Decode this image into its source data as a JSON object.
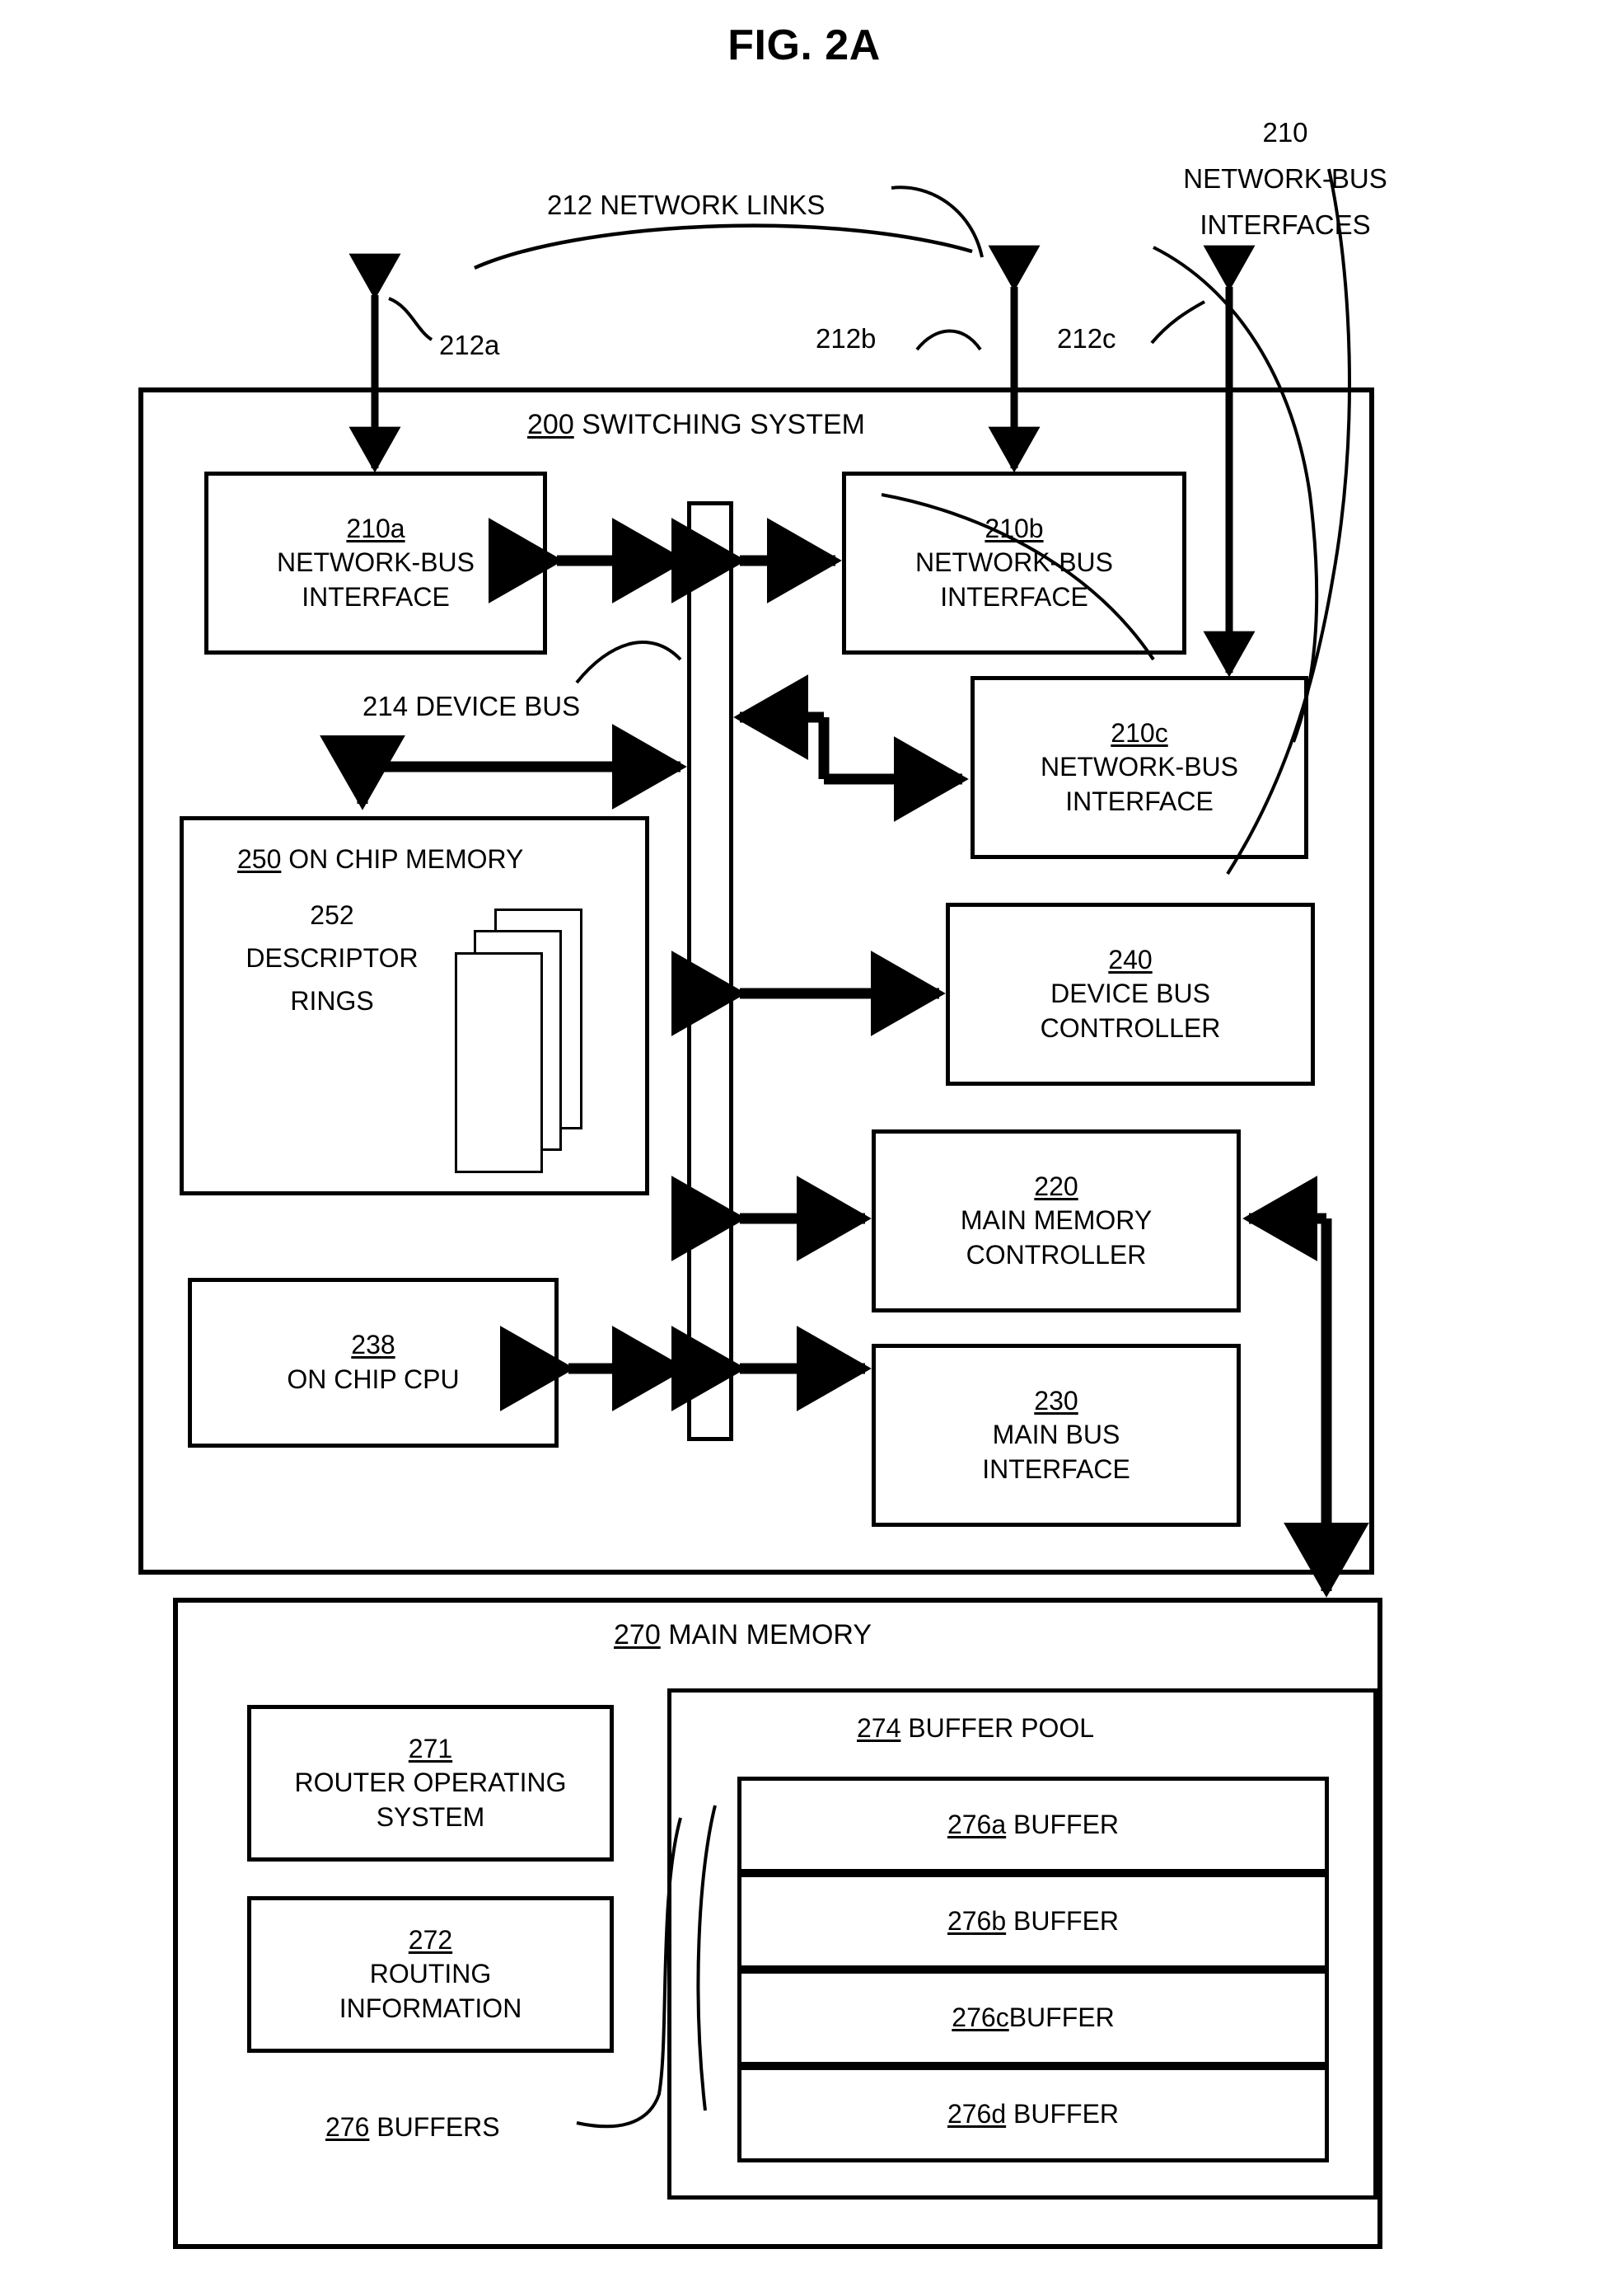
{
  "figure": {
    "title": "FIG. 2A"
  },
  "callouts": {
    "network_links": "212 NETWORK LINKS",
    "nbi_group_num": "210",
    "nbi_group_line1": "NETWORK-BUS",
    "nbi_group_line2": "INTERFACES",
    "link_a": "212a",
    "link_b": "212b",
    "link_c": "212c",
    "device_bus": "214 DEVICE BUS",
    "buffers": "276 BUFFERS"
  },
  "switching_system": {
    "num": "200",
    "name": "SWITCHING SYSTEM",
    "blocks": [
      {
        "id": "210a",
        "num": "210a",
        "line1": "NETWORK-BUS",
        "line2": "INTERFACE"
      },
      {
        "id": "210b",
        "num": "210b",
        "line1": "NETWORK-BUS",
        "line2": "INTERFACE"
      },
      {
        "id": "210c",
        "num": "210c",
        "line1": "NETWORK-BUS",
        "line2": "INTERFACE"
      },
      {
        "id": "240",
        "num": "240",
        "line1": "DEVICE BUS",
        "line2": "CONTROLLER"
      },
      {
        "id": "220",
        "num": "220",
        "line1": "MAIN MEMORY",
        "line2": "CONTROLLER"
      },
      {
        "id": "230",
        "num": "230",
        "line1": "MAIN BUS",
        "line2": "INTERFACE"
      },
      {
        "id": "238",
        "num": "238",
        "line1": "ON CHIP CPU",
        "line2": ""
      }
    ],
    "on_chip_memory": {
      "num": "250",
      "name": "ON CHIP MEMORY",
      "descriptor_rings": {
        "num": "252",
        "line1": "DESCRIPTOR",
        "line2": "RINGS",
        "sheet_count": 3
      }
    }
  },
  "main_memory": {
    "num": "270",
    "name": "MAIN MEMORY",
    "router_os": {
      "num": "271",
      "line1": "ROUTER OPERATING",
      "line2": "SYSTEM"
    },
    "routing_info": {
      "num": "272",
      "line1": "ROUTING",
      "line2": "INFORMATION"
    },
    "buffer_pool": {
      "num": "274",
      "name": "BUFFER POOL",
      "buffers": [
        {
          "num": "276a",
          "label": "BUFFER"
        },
        {
          "num": "276b",
          "label": "BUFFER"
        },
        {
          "num": "276c",
          "label": "BUFFER"
        },
        {
          "num": "276d",
          "label": "BUFFER"
        }
      ]
    }
  },
  "colors": {
    "ink": "#000000",
    "paper": "#ffffff"
  }
}
